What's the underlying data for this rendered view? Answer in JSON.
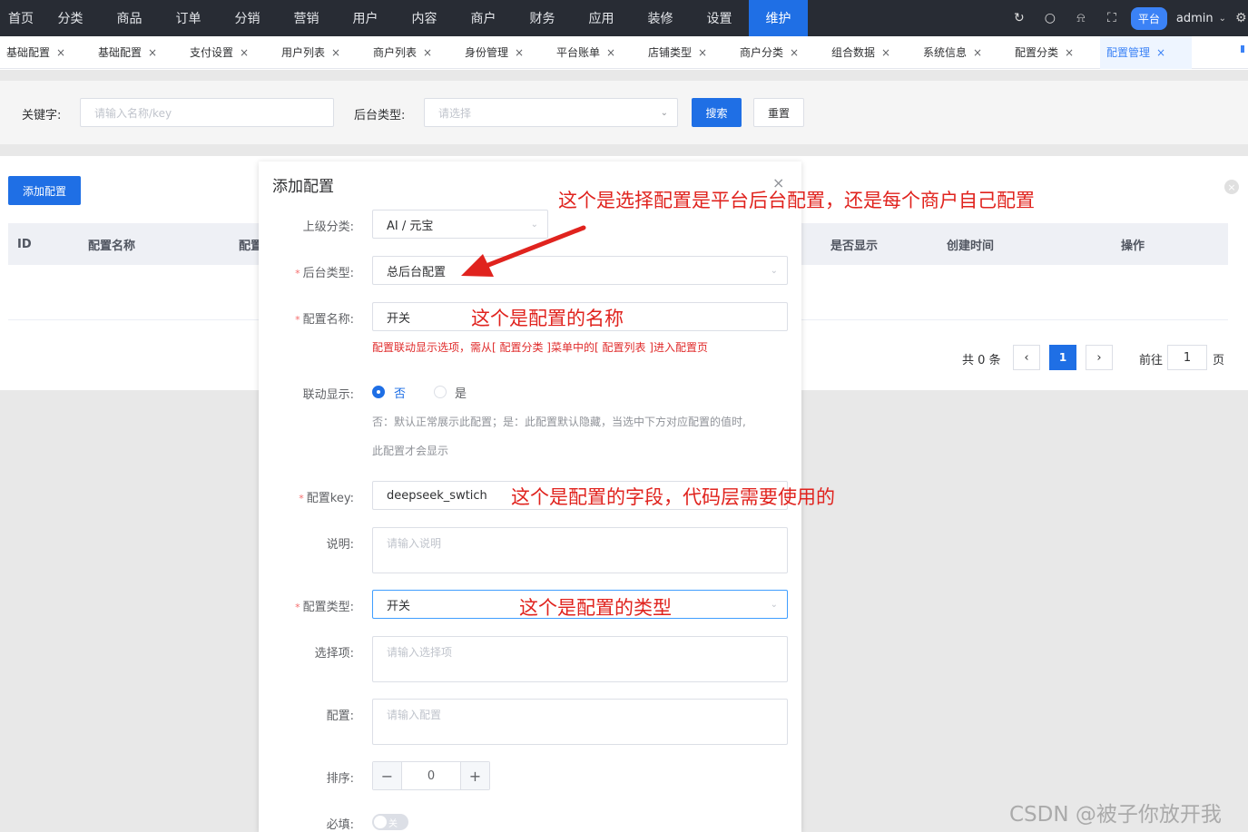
{
  "topnav": {
    "menu": [
      "首页",
      "分类",
      "商品",
      "订单",
      "分销",
      "营销",
      "用户",
      "内容",
      "商户",
      "财务",
      "应用",
      "装修",
      "设置",
      "维护"
    ],
    "active_index": 13,
    "platform_badge": "平台",
    "user": "admin"
  },
  "tabs": {
    "items": [
      "基础配置",
      "基础配置",
      "支付设置",
      "用户列表",
      "商户列表",
      "身份管理",
      "平台账单",
      "店铺类型",
      "商户分类",
      "组合数据",
      "系统信息",
      "配置分类",
      "配置管理"
    ],
    "active_index": 12,
    "close_glyph": "×"
  },
  "search": {
    "keyword_label": "关键字:",
    "keyword_placeholder": "请输入名称/key",
    "type_label": "后台类型:",
    "type_placeholder": "请选择",
    "search_button": "搜索",
    "reset_button": "重置"
  },
  "list": {
    "add_button": "添加配置",
    "columns": [
      "ID",
      "配置名称",
      "配置",
      "是否显示",
      "创建时间",
      "操作"
    ],
    "pagination": {
      "total_text": "共 0 条",
      "current_page": "1",
      "goto_label": "前往",
      "goto_value": "1",
      "page_suffix": "页"
    }
  },
  "dialog": {
    "title": "添加配置",
    "parent_label": "上级分类:",
    "parent_value": "AI / 元宝",
    "type_label": "后台类型:",
    "type_value": "总后台配置",
    "name_label": "配置名称:",
    "name_value": "开关",
    "linkage_hint": "配置联动显示选项，需从[ 配置分类 ]菜单中的[ 配置列表 ]进入配置页",
    "linkage_label": "联动显示:",
    "radio_no": "否",
    "radio_yes": "是",
    "linkage_desc_1": "否：默认正常展示此配置；是：此配置默认隐藏，当选中下方对应配置的值时,",
    "linkage_desc_2": "此配置才会显示",
    "key_label": "配置key:",
    "key_value": "deepseek_swtich",
    "desc_label": "说明:",
    "desc_placeholder": "请输入说明",
    "config_type_label": "配置类型:",
    "config_type_value": "开关",
    "options_label": "选择项:",
    "options_placeholder": "请输入选择项",
    "config_label": "配置:",
    "config_placeholder": "请输入配置",
    "sort_label": "排序:",
    "sort_value": "0",
    "required_label": "必填:",
    "required_switch_text": "关"
  },
  "annotations": {
    "type_note": "这个是选择配置是平台后台配置，还是每个商户自己配置",
    "name_note": "这个是配置的名称",
    "key_note": "这个是配置的字段，代码层需要使用的",
    "config_type_note": "这个是配置的类型"
  },
  "watermark": "CSDN @被子你放开我",
  "colors": {
    "nav_bg": "#282c34",
    "primary": "#1f6fe5",
    "annotation_red": "#e0231e"
  }
}
